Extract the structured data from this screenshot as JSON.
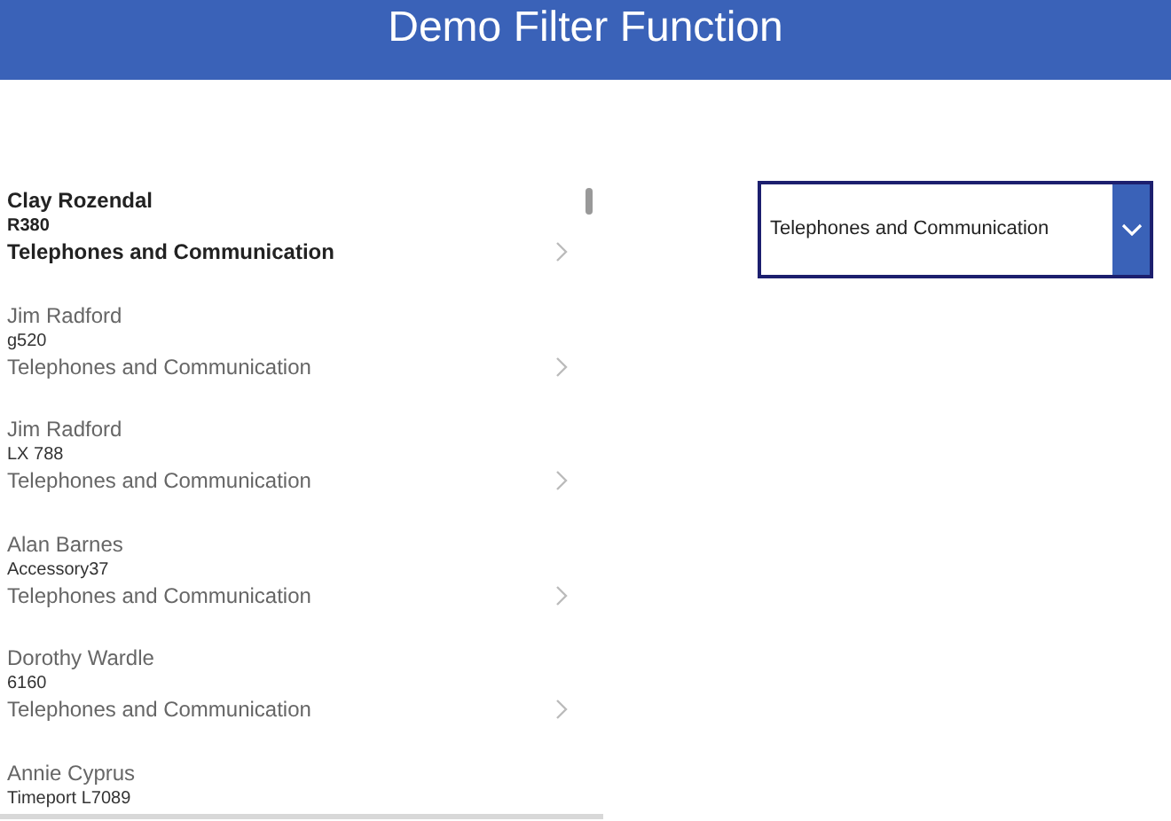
{
  "header": {
    "title": "Demo Filter Function"
  },
  "gallery": {
    "items": [
      {
        "name": "Clay Rozendal",
        "product": "R380",
        "category": "Telephones and Communication",
        "selected": true
      },
      {
        "name": "Jim Radford",
        "product": "g520",
        "category": "Telephones and Communication",
        "selected": false
      },
      {
        "name": "Jim Radford",
        "product": "LX 788",
        "category": "Telephones and Communication",
        "selected": false
      },
      {
        "name": "Alan Barnes",
        "product": "Accessory37",
        "category": "Telephones and Communication",
        "selected": false
      },
      {
        "name": "Dorothy Wardle",
        "product": "6160",
        "category": "Telephones and Communication",
        "selected": false
      },
      {
        "name": "Annie Cyprus",
        "product": "Timeport L7089",
        "selected": false
      }
    ]
  },
  "filter_dropdown": {
    "value": "Telephones and Communication"
  }
}
